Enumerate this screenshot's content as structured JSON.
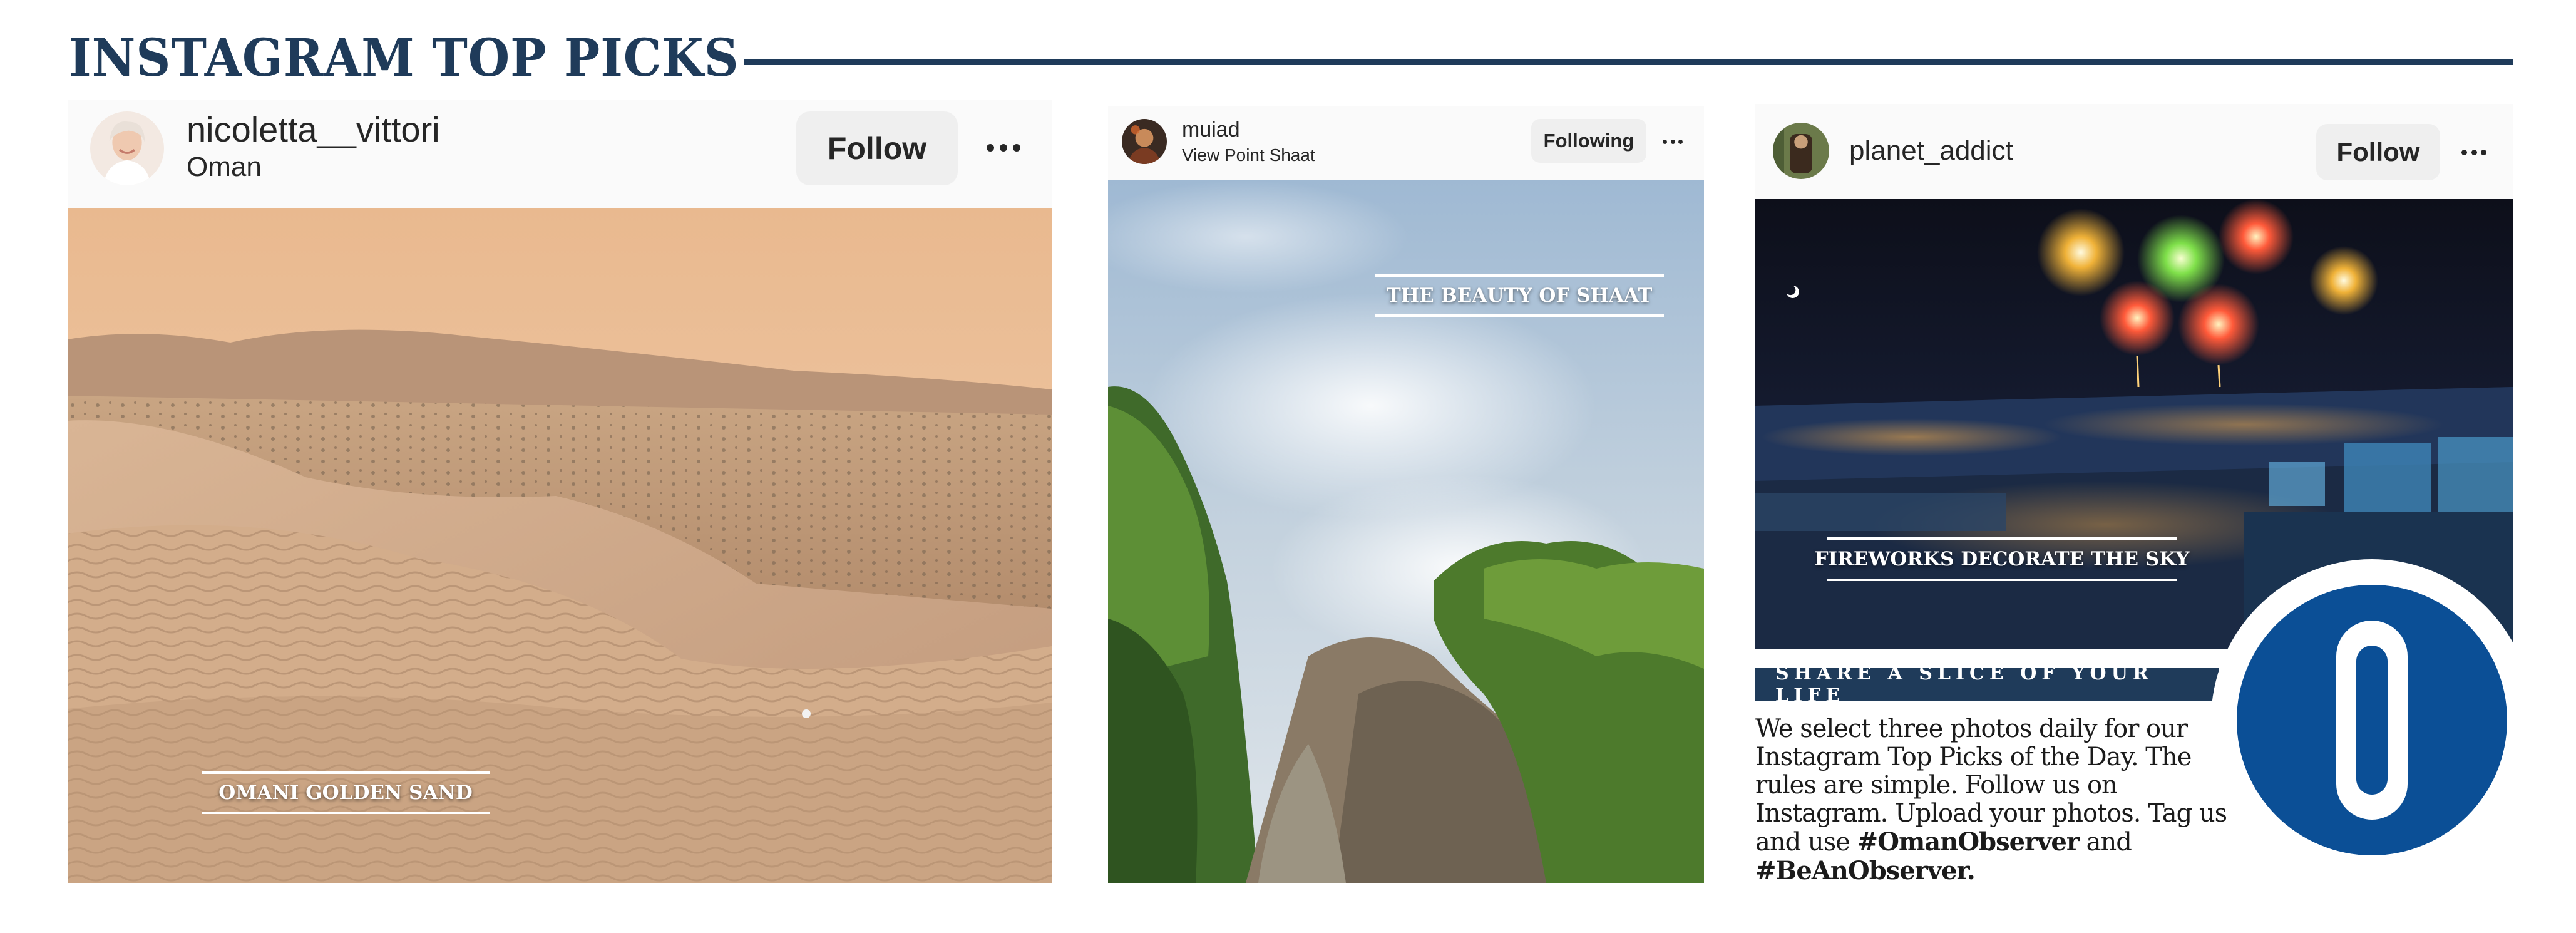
{
  "section": {
    "title": "INSTAGRAM TOP PICKS"
  },
  "posts": [
    {
      "username": "nicoletta__vittori",
      "location": "Oman",
      "button": "Follow",
      "caption": "OMANI GOLDEN SAND"
    },
    {
      "username": "muiad",
      "location": "View Point Shaat",
      "button": "Following",
      "caption": "THE BEAUTY OF SHAAT"
    },
    {
      "username": "planet_addict",
      "location": "",
      "button": "Follow",
      "caption": "FIREWORKS DECORATE THE SKY"
    }
  ],
  "promo": {
    "heading": "SHARE A SLICE OF YOUR LIFE",
    "body": "We select three photos daily for our Instagram Top Picks of the Day. The rules are simple. Follow us on Instagram. Upload your photos. Tag us and use ",
    "hashtag1": "#OmanObserver",
    "joiner": " and ",
    "hashtag2": "#BeAnObserver."
  },
  "colors": {
    "brand_navy": "#1f3b5a",
    "logo_blue": "#0b4f96",
    "button_bg": "#efefef"
  },
  "icons": [
    "more-options-icon",
    "avatar",
    "oman-observer-logo"
  ]
}
